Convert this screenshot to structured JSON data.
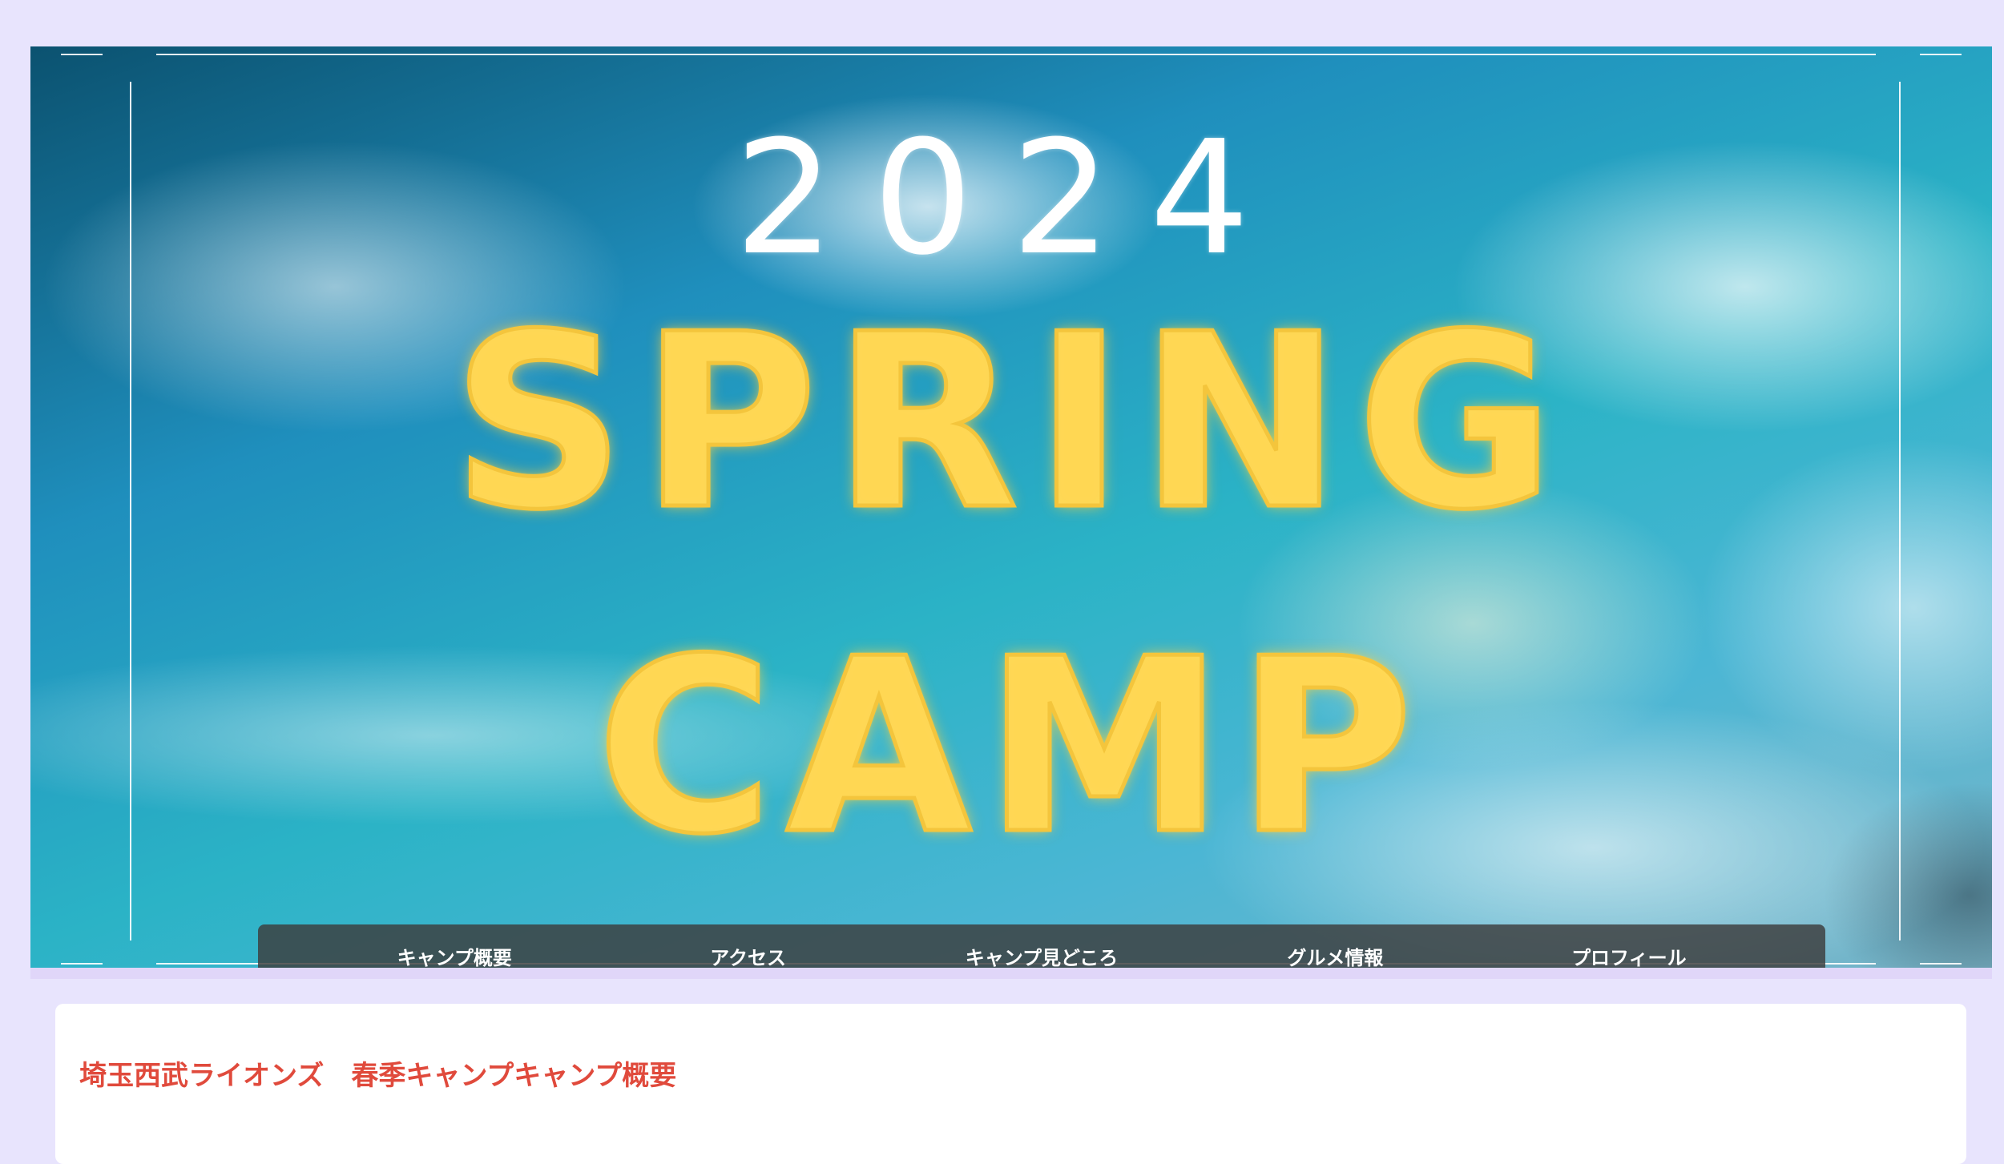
{
  "hero": {
    "year": "2024",
    "title_line1": "SPRING",
    "title_line2": "CAMP"
  },
  "nav": {
    "items": [
      {
        "label": "キャンプ概要"
      },
      {
        "label": "アクセス"
      },
      {
        "label": "キャンプ見どころ"
      },
      {
        "label": "グルメ情報"
      },
      {
        "label": "プロフィール"
      }
    ]
  },
  "content": {
    "heading": "埼玉西武ライオンズ　春季キャンプキャンプ概要"
  },
  "colors": {
    "page_background": "#e8e4fd",
    "nav_background": "#3c3c3c",
    "heading_red": "#e04a3c",
    "title_yellow": "#ffd754"
  }
}
